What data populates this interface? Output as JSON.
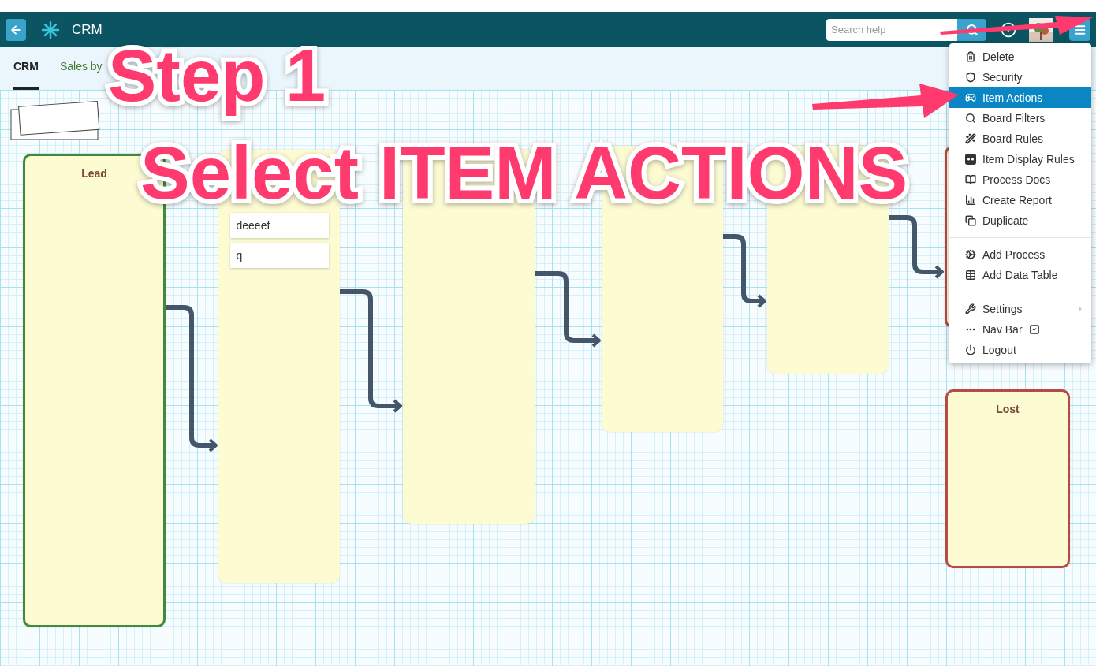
{
  "header": {
    "title": "CRM",
    "search": {
      "placeholder": "Search help"
    }
  },
  "subnav": {
    "tabs": [
      {
        "label": "CRM",
        "selected": true
      },
      {
        "label": "Sales by",
        "selected": false
      }
    ]
  },
  "board": {
    "stages": [
      {
        "kind": "column",
        "title": "Lead",
        "color": "#3f8a3f"
      },
      {
        "kind": "column",
        "cards": [
          "deeeef",
          "q"
        ]
      },
      {
        "kind": "column"
      },
      {
        "kind": "column"
      },
      {
        "kind": "column"
      },
      {
        "kind": "column",
        "color": "#b84a44"
      },
      {
        "kind": "column",
        "title": "Lost",
        "color": "#b84a44"
      }
    ]
  },
  "menu": {
    "groups": [
      [
        {
          "kind": "item",
          "label": "Delete",
          "selected": false
        },
        {
          "kind": "item",
          "label": "Security",
          "selected": false
        },
        {
          "kind": "item",
          "label": "Item Actions",
          "selected": true
        },
        {
          "kind": "item",
          "label": "Board Filters",
          "selected": false
        },
        {
          "kind": "item",
          "label": "Board Rules",
          "selected": false
        },
        {
          "kind": "item",
          "label": "Item Display Rules",
          "selected": false
        },
        {
          "kind": "item",
          "label": "Process Docs",
          "selected": false
        },
        {
          "kind": "item",
          "label": "Create Report",
          "selected": false
        },
        {
          "kind": "item",
          "label": "Duplicate",
          "selected": false
        }
      ],
      [
        {
          "kind": "item",
          "label": "Add Process",
          "selected": false
        },
        {
          "kind": "item",
          "label": "Add Data Table",
          "selected": false
        }
      ],
      [
        {
          "kind": "submenu",
          "label": "Settings",
          "selected": false
        },
        {
          "kind": "toggle",
          "label": "Nav Bar",
          "selected": false,
          "checked": true
        },
        {
          "kind": "item",
          "label": "Logout",
          "selected": false
        }
      ]
    ]
  },
  "annotations": [
    "Step 1",
    "Select ITEM ACTIONS"
  ]
}
